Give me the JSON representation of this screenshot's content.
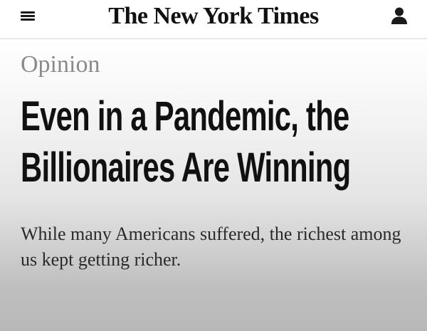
{
  "header": {
    "masthead": "The New York Times",
    "menu_icon": "hamburger-menu-icon",
    "account_icon": "person-icon"
  },
  "article": {
    "section": "Opinion",
    "headline": "Even in a Pandemic, the Billionaires Are Winning",
    "summary": "While many Americans suffered, the richest among us kept getting richer."
  },
  "colors": {
    "text": "#111111",
    "section_label": "#8a8a8a",
    "background_top": "#ffffff",
    "background_bottom": "#b8b8b8"
  }
}
